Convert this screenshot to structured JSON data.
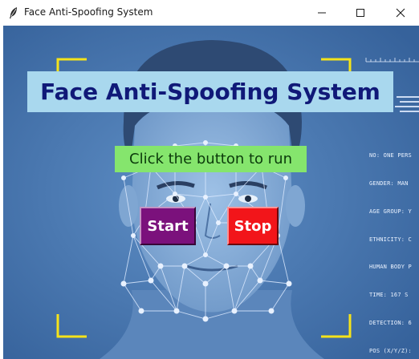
{
  "window": {
    "title": "Face Anti-Spoofing System",
    "icon": "feather-icon",
    "controls": {
      "minimize": "minimize-icon",
      "maximize": "maximize-icon",
      "close": "close-icon"
    }
  },
  "main": {
    "heading": "Face Anti-Spoofing System",
    "prompt": "Click the button to run",
    "start_label": "Start",
    "stop_label": "Stop"
  },
  "hud": {
    "lines": [
      "NO: ONE PERS",
      "GENDER: MAN",
      "AGE GROUP: Y",
      "ETHNICITY: C",
      "HUMAN BODY P",
      "TIME: 167 S",
      "DETECTION: 6",
      "POS (X/Y/Z):"
    ]
  },
  "colors": {
    "heading_bg": "#a9d8ee",
    "heading_text": "#101978",
    "prompt_bg": "#85e56d",
    "start_bg": "#7b117c",
    "stop_bg": "#f2151a",
    "corner_brackets": "#f5e31a",
    "background": "#3f6fa8"
  }
}
